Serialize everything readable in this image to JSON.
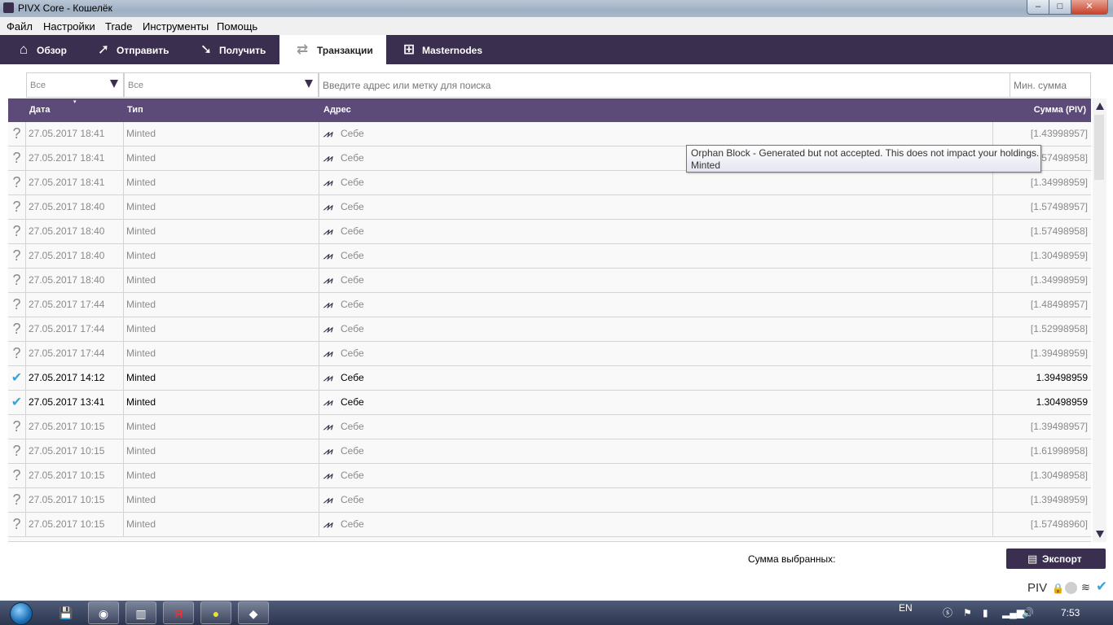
{
  "window": {
    "title": "PIVX Core - Кошелёк",
    "min_label": "–",
    "max_label": "□",
    "close_label": "✕"
  },
  "menu": [
    "Файл",
    "Настройки",
    "Trade",
    "Инструменты",
    "Помощь"
  ],
  "toolbar": {
    "tabs": [
      {
        "label": "Обзор",
        "icon": "home-icon",
        "glyph": "⌂"
      },
      {
        "label": "Отправить",
        "icon": "send-icon",
        "glyph": "➚"
      },
      {
        "label": "Получить",
        "icon": "receive-icon",
        "glyph": "➘"
      },
      {
        "label": "Транзакции",
        "icon": "transactions-icon",
        "glyph": "⇄",
        "active": true
      },
      {
        "label": "Masternodes",
        "icon": "masternodes-icon",
        "glyph": "⊞"
      }
    ]
  },
  "filters": {
    "date_filter": "Все",
    "type_filter": "Все",
    "search_placeholder": "Введите адрес или метку для поиска",
    "min_amount_placeholder": "Мин. сумма"
  },
  "table": {
    "headers": {
      "date": "Дата",
      "type": "Тип",
      "address": "Адрес",
      "amount": "Сумма (PIV)"
    },
    "rows": [
      {
        "status": "?",
        "confirmed": false,
        "date": "27.05.2017 18:41",
        "type": "Minted",
        "address": "Себе",
        "amount": "[1.43998957]"
      },
      {
        "status": "?",
        "confirmed": false,
        "date": "27.05.2017 18:41",
        "type": "Minted",
        "address": "Себе",
        "amount": "[1.57498958]"
      },
      {
        "status": "?",
        "confirmed": false,
        "date": "27.05.2017 18:41",
        "type": "Minted",
        "address": "Себе",
        "amount": "[1.34998959]"
      },
      {
        "status": "?",
        "confirmed": false,
        "date": "27.05.2017 18:40",
        "type": "Minted",
        "address": "Себе",
        "amount": "[1.57498957]"
      },
      {
        "status": "?",
        "confirmed": false,
        "date": "27.05.2017 18:40",
        "type": "Minted",
        "address": "Себе",
        "amount": "[1.57498958]"
      },
      {
        "status": "?",
        "confirmed": false,
        "date": "27.05.2017 18:40",
        "type": "Minted",
        "address": "Себе",
        "amount": "[1.30498959]"
      },
      {
        "status": "?",
        "confirmed": false,
        "date": "27.05.2017 18:40",
        "type": "Minted",
        "address": "Себе",
        "amount": "[1.34998959]"
      },
      {
        "status": "?",
        "confirmed": false,
        "date": "27.05.2017 17:44",
        "type": "Minted",
        "address": "Себе",
        "amount": "[1.48498957]"
      },
      {
        "status": "?",
        "confirmed": false,
        "date": "27.05.2017 17:44",
        "type": "Minted",
        "address": "Себе",
        "amount": "[1.52998958]"
      },
      {
        "status": "?",
        "confirmed": false,
        "date": "27.05.2017 17:44",
        "type": "Minted",
        "address": "Себе",
        "amount": "[1.39498959]"
      },
      {
        "status": "✔",
        "confirmed": true,
        "date": "27.05.2017 14:12",
        "type": "Minted",
        "address": "Себе",
        "amount": "1.39498959"
      },
      {
        "status": "✔",
        "confirmed": true,
        "date": "27.05.2017 13:41",
        "type": "Minted",
        "address": "Себе",
        "amount": "1.30498959"
      },
      {
        "status": "?",
        "confirmed": false,
        "date": "27.05.2017 10:15",
        "type": "Minted",
        "address": "Себе",
        "amount": "[1.39498957]"
      },
      {
        "status": "?",
        "confirmed": false,
        "date": "27.05.2017 10:15",
        "type": "Minted",
        "address": "Себе",
        "amount": "[1.61998958]"
      },
      {
        "status": "?",
        "confirmed": false,
        "date": "27.05.2017 10:15",
        "type": "Minted",
        "address": "Себе",
        "amount": "[1.30498958]"
      },
      {
        "status": "?",
        "confirmed": false,
        "date": "27.05.2017 10:15",
        "type": "Minted",
        "address": "Себе",
        "amount": "[1.39498959]"
      },
      {
        "status": "?",
        "confirmed": false,
        "date": "27.05.2017 10:15",
        "type": "Minted",
        "address": "Себе",
        "amount": "[1.57498960]"
      }
    ]
  },
  "tooltip": {
    "line1": "Orphan Block - Generated but not accepted. This does not impact your holdings.",
    "line2": "Minted"
  },
  "footer": {
    "sum_label": "Сумма выбранных:",
    "export_label": "Экспорт"
  },
  "statusbar": {
    "unit": "PIV",
    "lock_icon": "lock-icon",
    "staking_icon": "staking-icon",
    "network_icon": "network-icon",
    "synced_icon": "synced-check-icon"
  },
  "taskbar": {
    "language": "EN",
    "clock": "7:53"
  },
  "colors": {
    "brand": "#3b2f4f",
    "header": "#5c4b78",
    "confirmed_check": "#3aa4d8"
  }
}
